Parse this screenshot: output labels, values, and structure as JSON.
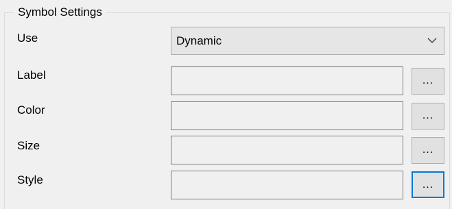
{
  "group": {
    "title": "Symbol Settings"
  },
  "use": {
    "label": "Use",
    "value": "Dynamic",
    "arrow_icon": "chevron-down-icon"
  },
  "fields": [
    {
      "label": "Label",
      "value": "",
      "button_label": "..."
    },
    {
      "label": "Color",
      "value": "",
      "button_label": "..."
    },
    {
      "label": "Size",
      "value": "",
      "button_label": "..."
    },
    {
      "label": "Style",
      "value": "",
      "button_label": "...",
      "focused": true
    }
  ],
  "colors": {
    "focus_border": "#0078d7",
    "background": "#f0f0f0"
  }
}
